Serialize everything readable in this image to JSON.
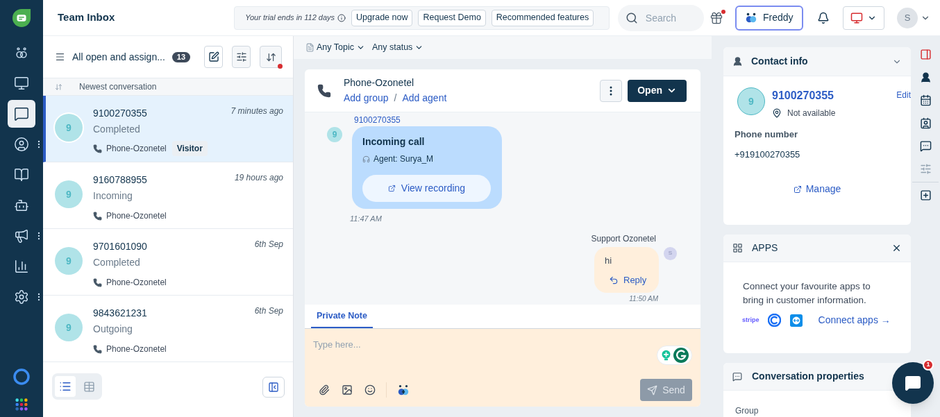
{
  "top_bar": {
    "title": "Team Inbox",
    "trial_text": "Your trial ends in 112 days",
    "trial_buttons": [
      "Upgrade now",
      "Request Demo",
      "Recommended features"
    ],
    "search": {
      "placeholder": "Search"
    },
    "gift_notification": true,
    "freddy_button": "Freddy",
    "avatar": "S"
  },
  "nav": {
    "items": [
      {
        "selected": false,
        "has_menu": false
      },
      {
        "selected": false,
        "has_menu": false
      },
      {
        "selected": true,
        "has_menu": false
      },
      {
        "selected": false,
        "has_menu": true
      },
      {
        "selected": false,
        "has_menu": false
      },
      {
        "selected": false,
        "has_menu": false
      },
      {
        "selected": false,
        "has_menu": true
      },
      {
        "selected": false,
        "has_menu": false
      },
      {
        "selected": false,
        "has_menu": true
      }
    ]
  },
  "list": {
    "view_name": "All open and assign...",
    "count": "13",
    "sort_notification": true,
    "sort_label": "Newest conversation",
    "conversations": [
      {
        "avatar": "9",
        "number": "9100270355",
        "status": "Completed",
        "time": "7 minutes ago",
        "channel": "Phone-Ozonetel",
        "tag": "Visitor",
        "selected": true
      },
      {
        "avatar": "9",
        "number": "9160788955",
        "status": "Incoming",
        "time": "19 hours ago",
        "channel": "Phone-Ozonetel",
        "selected": false
      },
      {
        "avatar": "9",
        "number": "9701601090",
        "status": "Completed",
        "time": "6th Sep",
        "channel": "Phone-Ozonetel",
        "selected": false
      },
      {
        "avatar": "9",
        "number": "9843621231",
        "status": "Outgoing",
        "time": "6th Sep",
        "channel": "Phone-Ozonetel",
        "selected": false
      }
    ],
    "view_modes": [
      {
        "selected": true
      },
      {
        "selected": false
      }
    ]
  },
  "filters": [
    "Any Topic",
    "Any status"
  ],
  "conversation": {
    "channel": "Phone-Ozonetel",
    "links": [
      "Add group",
      "Add agent"
    ],
    "link_separator": "/",
    "status_button": "Open",
    "messages": [
      {
        "kind": "call",
        "sender": "9100270355",
        "avatar": "9",
        "title": "Incoming call",
        "agent": "Agent: Surya_M",
        "action": "View recording",
        "time": "11:47 AM"
      },
      {
        "kind": "text",
        "sender": "Support Ozonetel",
        "avatar": "S",
        "text": "hi",
        "action": "Reply",
        "time": "11:50 AM"
      }
    ],
    "editor": {
      "tabs": [
        {
          "label": "Private Note",
          "selected": true
        }
      ],
      "placeholder": "Type here...",
      "send": "Send",
      "send_disabled": true
    }
  },
  "contact_info": {
    "title": "Contact info",
    "avatar": "9",
    "name": "9100270355",
    "edit": "Edit",
    "location": "Not available",
    "field_label": "Phone number",
    "field_value": "+919100270355",
    "manage": "Manage"
  },
  "apps": {
    "title": "APPS",
    "text": "Connect your favourite apps to bring in customer information.",
    "logo_text": "stripe",
    "link": "Connect apps →"
  },
  "conversation_properties": {
    "title": "Conversation properties",
    "field_label": "Group"
  },
  "chat_widget": {
    "badge": "1"
  }
}
